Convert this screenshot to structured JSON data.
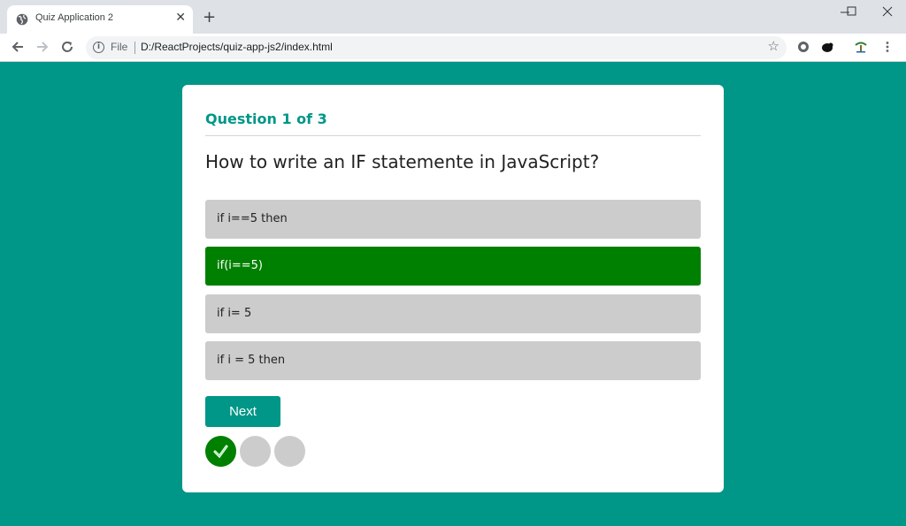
{
  "browser": {
    "tab_title": "Quiz Application 2",
    "tab_close": "✕",
    "new_tab": "+",
    "omnibox": {
      "info": "i",
      "scheme_label": "File",
      "url": "D:/ReactProjects/quiz-app-js2/index.html"
    }
  },
  "quiz": {
    "question_counter": "Question 1 of 3",
    "question_text": "How to write an IF statemente in JavaScript?",
    "options": [
      {
        "label": "if i==5 then",
        "state": "default"
      },
      {
        "label": "if(i==5)",
        "state": "correct"
      },
      {
        "label": "if i= 5",
        "state": "default"
      },
      {
        "label": "if i = 5 then",
        "state": "default"
      }
    ],
    "next_label": "Next",
    "progress": {
      "total": 3,
      "answered": [
        true,
        false,
        false
      ]
    }
  },
  "colors": {
    "accent": "#009688",
    "correct": "#008000",
    "option_default": "#cccccc"
  }
}
